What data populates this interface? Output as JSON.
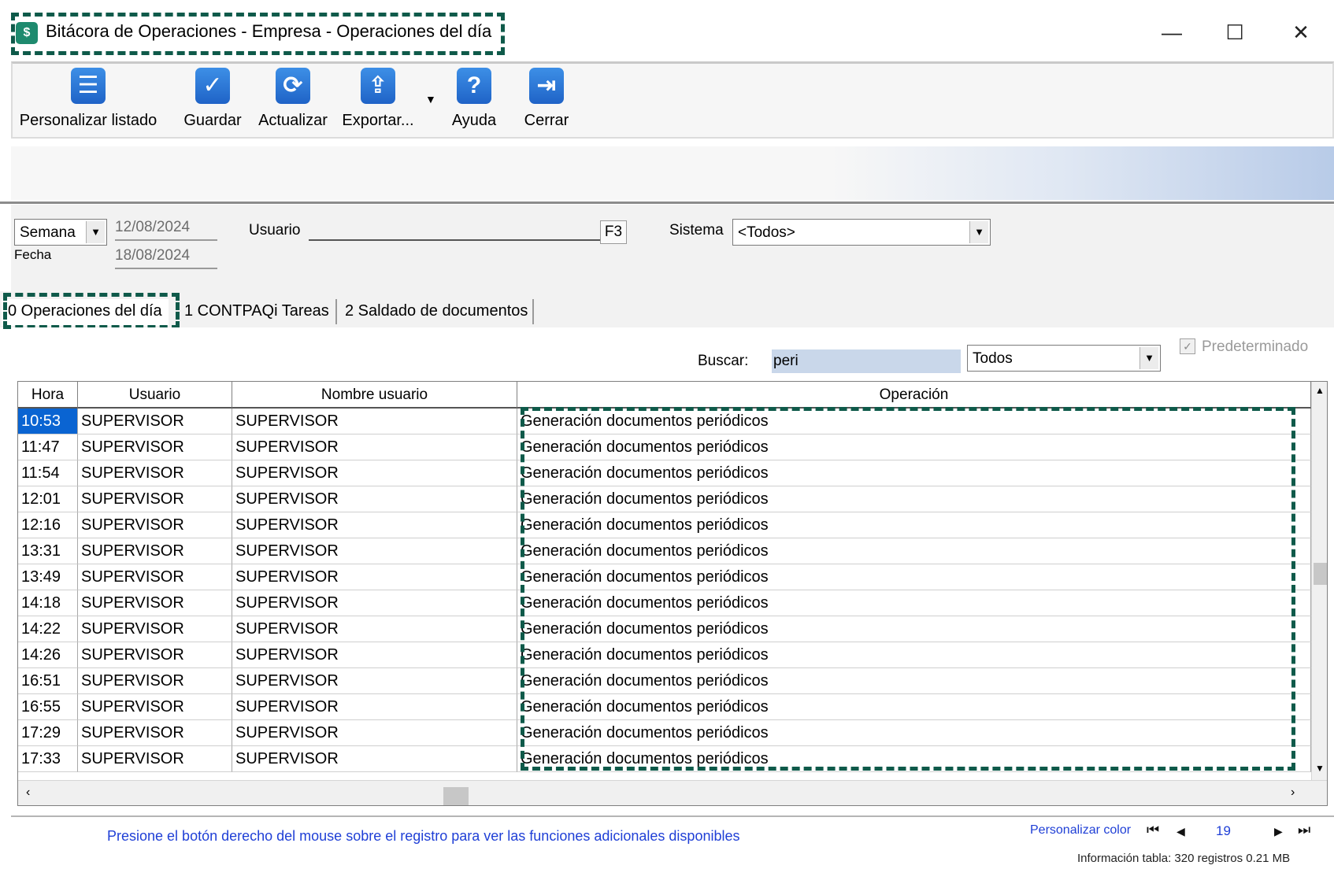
{
  "window": {
    "title": "Bitácora de Operaciones - Empresa - Operaciones del día",
    "app_icon": "$",
    "minimize": "—",
    "maximize": "☐",
    "close": "✕"
  },
  "toolbar": {
    "buttons": [
      {
        "label": "Personalizar listado",
        "icon": "list-icon",
        "glyph": "☰"
      },
      {
        "label": "Guardar",
        "icon": "checkmark-icon",
        "glyph": "✓"
      },
      {
        "label": "Actualizar",
        "icon": "refresh-icon",
        "glyph": "⟳"
      },
      {
        "label": "Exportar...",
        "icon": "export-icon",
        "glyph": "⇪"
      },
      {
        "label": "Ayuda",
        "icon": "help-icon",
        "glyph": "?"
      },
      {
        "label": "Cerrar",
        "icon": "exit-door-icon",
        "glyph": "⇥"
      }
    ]
  },
  "filters": {
    "period_value": "Semana",
    "fecha_label": "Fecha",
    "date_from": "12/08/2024",
    "date_to": "18/08/2024",
    "usuario_label": "Usuario",
    "usuario_value": "",
    "f3_label": "F3",
    "sistema_label": "Sistema",
    "sistema_value": "<Todos>"
  },
  "tabs": [
    {
      "label": "0 Operaciones del día",
      "active": true
    },
    {
      "label": "1 CONTPAQi Tareas",
      "active": false
    },
    {
      "label": "2 Saldado de documentos",
      "active": false
    }
  ],
  "search": {
    "label": "Buscar:",
    "value": "peri",
    "scope": "Todos",
    "predeterminado_label": "Predeterminado",
    "predeterminado_checked": true
  },
  "grid": {
    "columns": [
      "Hora",
      "Usuario",
      "Nombre usuario",
      "Operación"
    ],
    "rows": [
      [
        "10:53",
        "SUPERVISOR",
        "SUPERVISOR",
        "Generación documentos periódicos"
      ],
      [
        "11:47",
        "SUPERVISOR",
        "SUPERVISOR",
        "Generación documentos periódicos"
      ],
      [
        "11:54",
        "SUPERVISOR",
        "SUPERVISOR",
        "Generación documentos periódicos"
      ],
      [
        "12:01",
        "SUPERVISOR",
        "SUPERVISOR",
        "Generación documentos periódicos"
      ],
      [
        "12:16",
        "SUPERVISOR",
        "SUPERVISOR",
        "Generación documentos periódicos"
      ],
      [
        "13:31",
        "SUPERVISOR",
        "SUPERVISOR",
        "Generación documentos periódicos"
      ],
      [
        "13:49",
        "SUPERVISOR",
        "SUPERVISOR",
        "Generación documentos periódicos"
      ],
      [
        "14:18",
        "SUPERVISOR",
        "SUPERVISOR",
        "Generación documentos periódicos"
      ],
      [
        "14:22",
        "SUPERVISOR",
        "SUPERVISOR",
        "Generación documentos periódicos"
      ],
      [
        "14:26",
        "SUPERVISOR",
        "SUPERVISOR",
        "Generación documentos periódicos"
      ],
      [
        "16:51",
        "SUPERVISOR",
        "SUPERVISOR",
        "Generación documentos periódicos"
      ],
      [
        "16:55",
        "SUPERVISOR",
        "SUPERVISOR",
        "Generación documentos periódicos"
      ],
      [
        "17:29",
        "SUPERVISOR",
        "SUPERVISOR",
        "Generación documentos periódicos"
      ],
      [
        "17:33",
        "SUPERVISOR",
        "SUPERVISOR",
        "Generación documentos periódicos"
      ]
    ],
    "selected_row": 0
  },
  "footer": {
    "hint": "Presione el botón derecho del mouse sobre el registro para ver las funciones adicionales disponibles",
    "personalizar_color": "Personalizar color",
    "page": "19",
    "nav_first": "⏮",
    "nav_prev": "◀",
    "nav_next": "▶",
    "nav_last": "⏭",
    "table_info": "Información tabla: 320 registros 0.21 MB"
  },
  "colors": {
    "highlight_border": "#0f5a4a",
    "selection": "#0a64d2",
    "link_blue": "#1f3fd6",
    "toolbar_icon": "#1f63c7"
  }
}
